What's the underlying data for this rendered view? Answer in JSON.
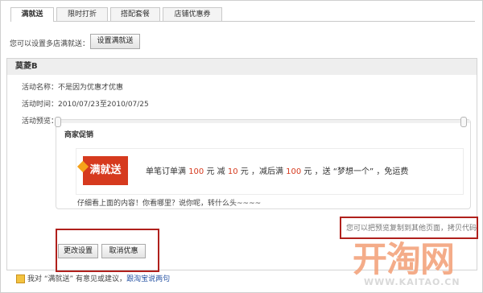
{
  "tabs": [
    {
      "label": "满就送",
      "active": true
    },
    {
      "label": "限时打折",
      "active": false
    },
    {
      "label": "搭配套餐",
      "active": false
    },
    {
      "label": "店铺优惠券",
      "active": false
    }
  ],
  "intro": {
    "text": "您可以设置多店满就送：",
    "button": "设置满就送"
  },
  "activity": {
    "title": "莫菱B",
    "name_label": "活动名称：",
    "name_value": "不是因为优惠才优惠",
    "time_label": "活动时间：",
    "time_value": "2010/07/23至2010/07/25",
    "preview_label": "活动预览："
  },
  "preview": {
    "header": "商家促销",
    "badge": "满就送",
    "promo": {
      "p1": "单笔订单满",
      "v1": "100",
      "p2": "元 减",
      "v2": "10",
      "p3": "元 ，减后满",
      "v3": "100",
      "p4": "元 ，送 “梦想一个” ，免运费"
    },
    "footer_text": "仔细看上面的内容！你看哪里？说你呢，转什么头~~~~"
  },
  "code_hint": "您可以把预览复制到其他页面，拷贝代码",
  "actions": {
    "modify": "更改设置",
    "cancel": "取消优惠"
  },
  "feedback": {
    "text": "我对 “满就送” 有意见或建议，",
    "link": "跟淘宝说两句"
  },
  "watermark": {
    "logo": "开淘网",
    "url": "WWW.KAITAO.CN"
  },
  "colors": {
    "accent_red": "#b0201c",
    "badge_red": "#d63a1e",
    "link_blue": "#2a56a5",
    "watermark_orange": "#f3a47d"
  }
}
